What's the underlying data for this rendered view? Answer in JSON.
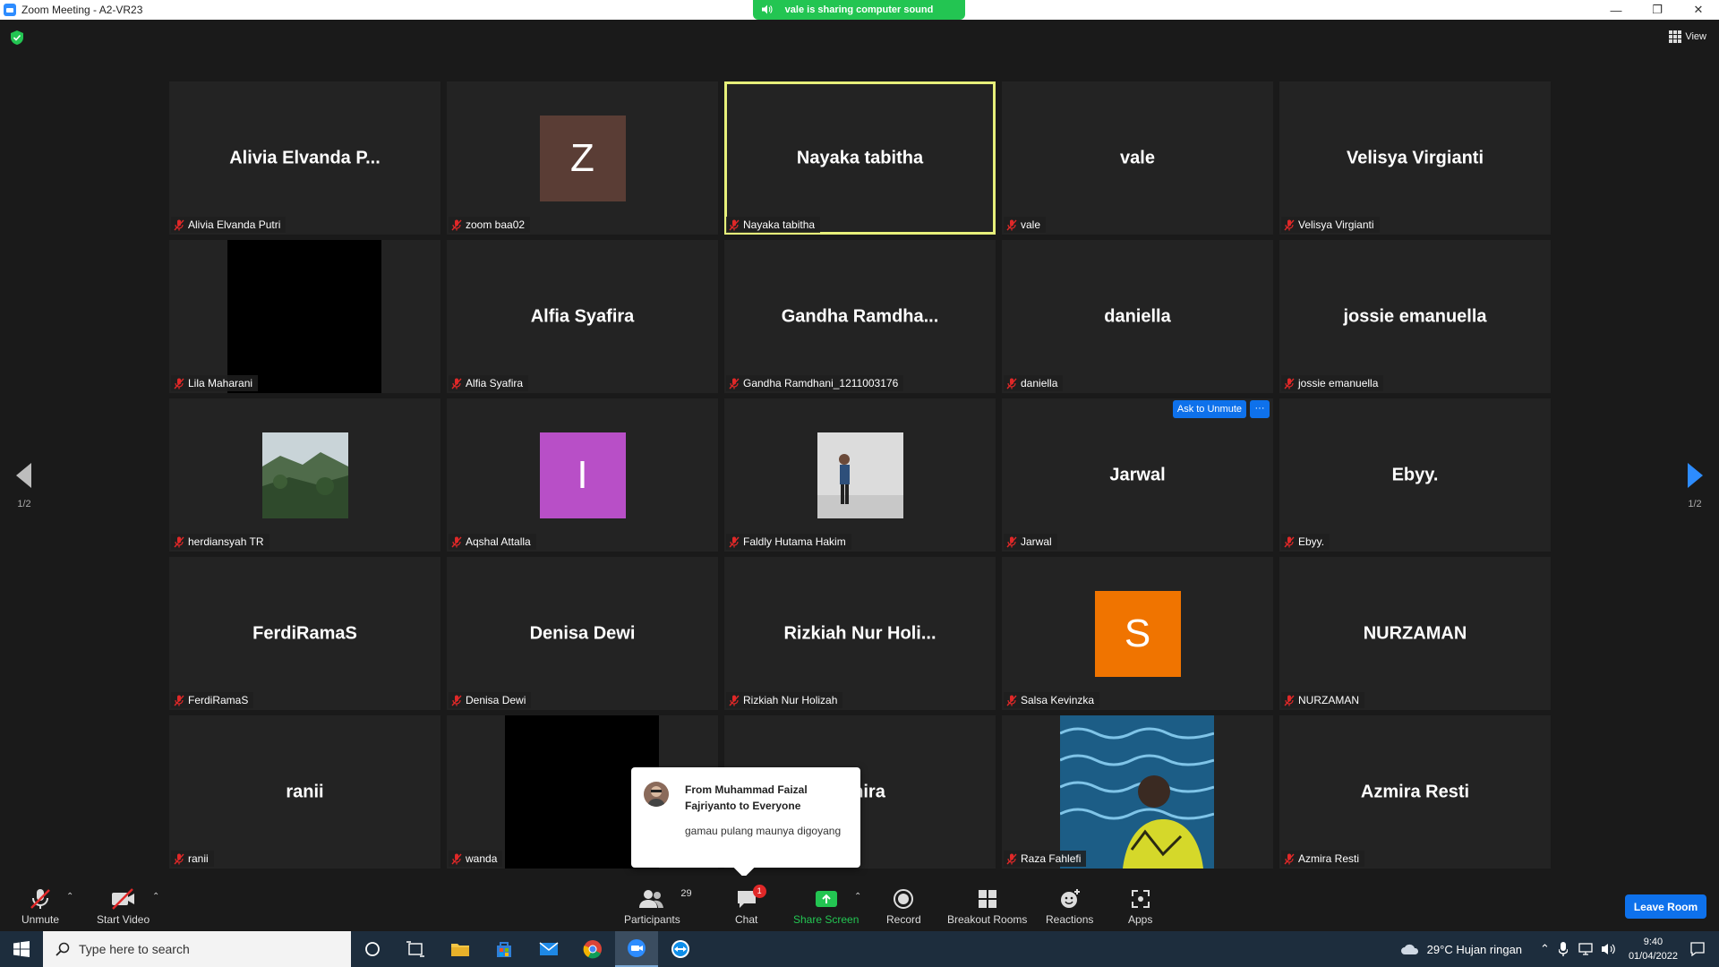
{
  "window": {
    "title": "Zoom Meeting - A2-VR23",
    "sharing_banner": "vale is sharing computer sound",
    "view_label": "View"
  },
  "gallery": {
    "page_indicator": "1/2",
    "ask_to_unmute": "Ask to Unmute",
    "more": "···",
    "tiles": [
      {
        "big": "Alivia  Elvanda  P...",
        "label": "Alivia Elvanda Putri"
      },
      {
        "avatar": "Z",
        "label": "zoom baa02",
        "avatar_color": "#5a3d35"
      },
      {
        "big": "Nayaka  tabitha",
        "label": "Nayaka tabitha",
        "active": true
      },
      {
        "big": "vale",
        "label": "vale"
      },
      {
        "big": "Velisya  Virgianti",
        "label": "Velisya Virgianti"
      },
      {
        "black": true,
        "label": "Lila Maharani"
      },
      {
        "big": "Alfia  Syafira",
        "label": "Alfia Syafira"
      },
      {
        "big": "Gandha  Ramdha...",
        "label": "Gandha Ramdhani_1211003176"
      },
      {
        "big": "daniella",
        "label": "daniella"
      },
      {
        "big": "jossie  emanuella",
        "label": "jossie emanuella"
      },
      {
        "photo": "landscape",
        "label": "herdiansyah TR"
      },
      {
        "avatar": "I",
        "label": "Aqshal Attalla",
        "avatar_color": "#b84fc7"
      },
      {
        "photo": "person",
        "label": "Faldly Hutama Hakim"
      },
      {
        "big": "Jarwal",
        "label": "Jarwal",
        "ask": true
      },
      {
        "big": "Ebyy.",
        "label": "Ebyy."
      },
      {
        "big": "FerdiRamaS",
        "label": "FerdiRamaS"
      },
      {
        "big": "Denisa  Dewi",
        "label": "Denisa Dewi"
      },
      {
        "big": "Rizkiah  Nur  Holi...",
        "label": "Rizkiah Nur Holizah"
      },
      {
        "avatar": "S",
        "label": "Salsa Kevinzka",
        "avatar_color": "#f07400"
      },
      {
        "big": "NURZAMAN",
        "label": "NURZAMAN"
      },
      {
        "big": "ranii",
        "label": "ranii"
      },
      {
        "black": true,
        "label": "wanda"
      },
      {
        "big": "Amira",
        "label": ""
      },
      {
        "photo": "pool",
        "label": "Raza Fahlefi"
      },
      {
        "big": "Azmira  Resti",
        "label": "Azmira Resti"
      }
    ]
  },
  "chat_popup": {
    "from": "From Muhammad Faizal Fajriyanto to Everyone",
    "message": "gamau pulang maunya digoyang"
  },
  "toolbar": {
    "unmute": "Unmute",
    "start_video": "Start Video",
    "participants": "Participants",
    "participants_count": "29",
    "chat": "Chat",
    "chat_badge": "1",
    "share_screen": "Share Screen",
    "record": "Record",
    "breakout_rooms": "Breakout Rooms",
    "reactions": "Reactions",
    "apps": "Apps",
    "leave": "Leave Room"
  },
  "taskbar": {
    "search_placeholder": "Type here to search",
    "weather": "29°C  Hujan ringan",
    "time": "9:40",
    "date": "01/04/2022"
  },
  "colors": {
    "active_speaker": "#e6ef7a",
    "sharing_banner": "#23c552",
    "zoom_blue": "#0e71eb",
    "share_green": "#23c552"
  }
}
